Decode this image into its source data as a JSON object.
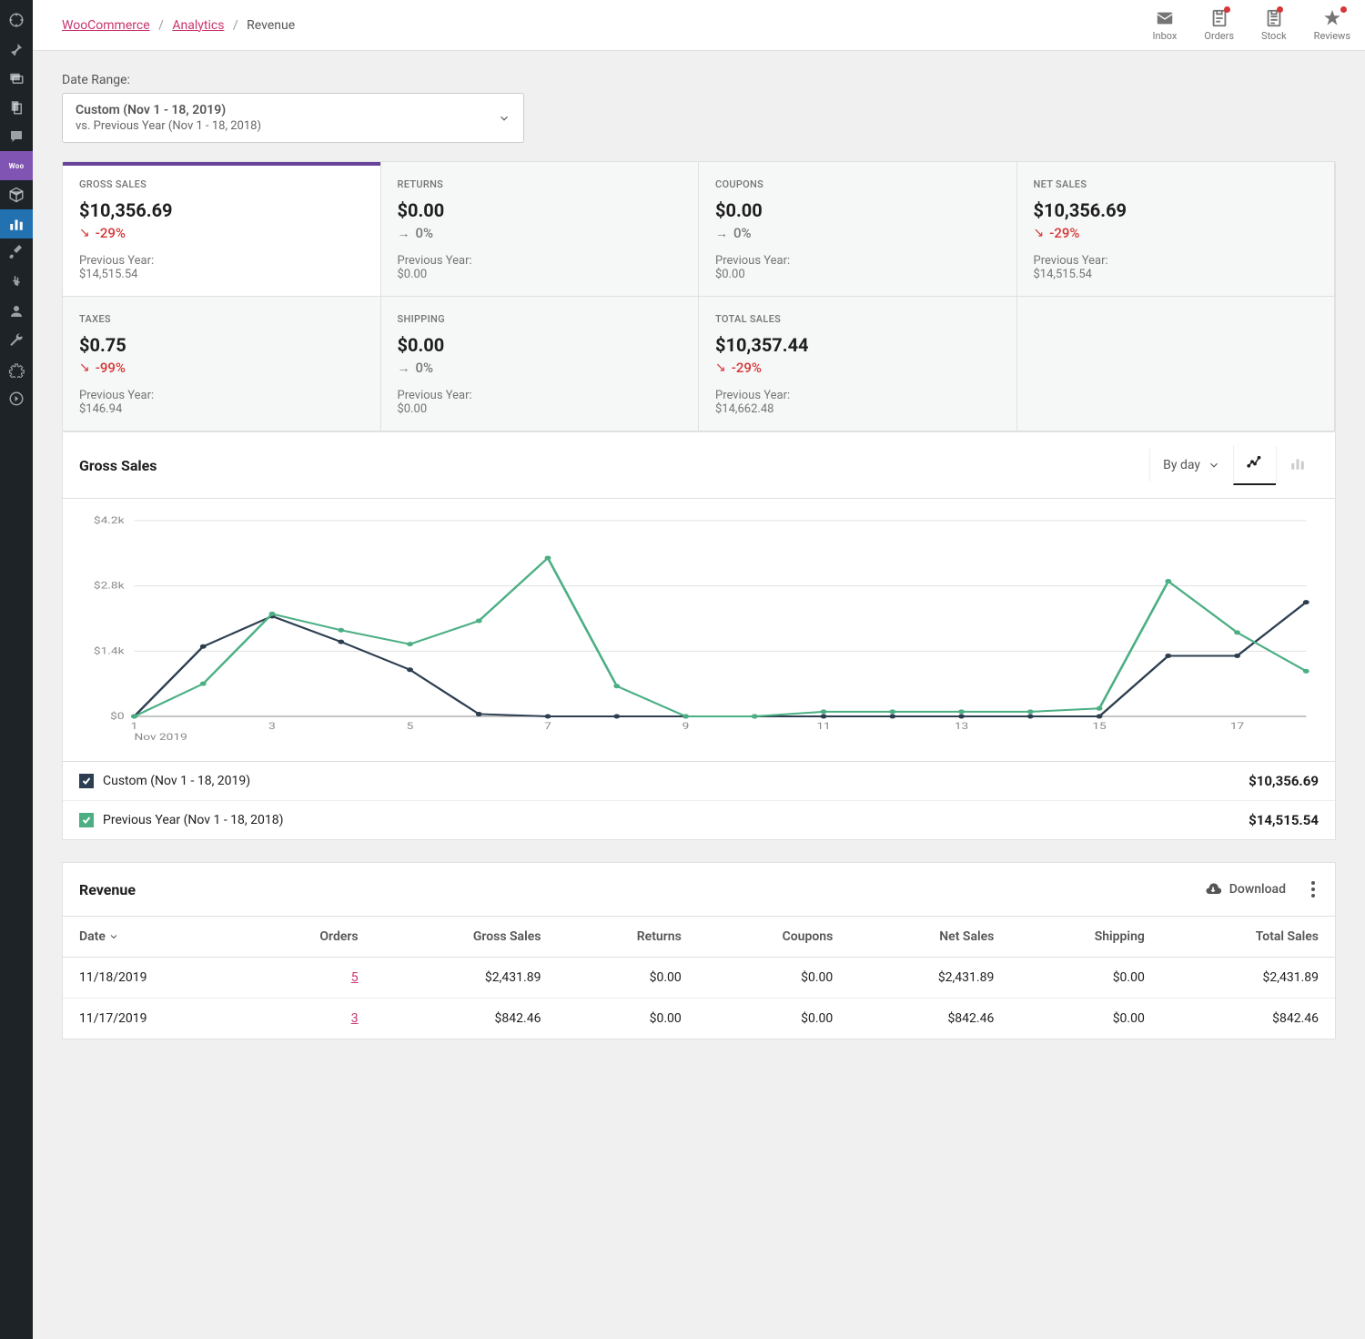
{
  "breadcrumbs": {
    "root": "WooCommerce",
    "section": "Analytics",
    "page": "Revenue"
  },
  "header": {
    "inbox": "Inbox",
    "orders": "Orders",
    "stock": "Stock",
    "reviews": "Reviews"
  },
  "date_range": {
    "label": "Date Range:",
    "title": "Custom (Nov 1 - 18, 2019)",
    "compare": "vs. Previous Year (Nov 1 - 18, 2018)"
  },
  "kpis": {
    "gross_sales": {
      "label": "GROSS SALES",
      "value": "$10,356.69",
      "delta": "-29%",
      "trend": "down",
      "prev_label": "Previous Year:",
      "prev": "$14,515.54"
    },
    "returns": {
      "label": "RETURNS",
      "value": "$0.00",
      "delta": "0%",
      "trend": "flat",
      "prev_label": "Previous Year:",
      "prev": "$0.00"
    },
    "coupons": {
      "label": "COUPONS",
      "value": "$0.00",
      "delta": "0%",
      "trend": "flat",
      "prev_label": "Previous Year:",
      "prev": "$0.00"
    },
    "net_sales": {
      "label": "NET SALES",
      "value": "$10,356.69",
      "delta": "-29%",
      "trend": "down",
      "prev_label": "Previous Year:",
      "prev": "$14,515.54"
    },
    "taxes": {
      "label": "TAXES",
      "value": "$0.75",
      "delta": "-99%",
      "trend": "down",
      "prev_label": "Previous Year:",
      "prev": "$146.94"
    },
    "shipping": {
      "label": "SHIPPING",
      "value": "$0.00",
      "delta": "0%",
      "trend": "flat",
      "prev_label": "Previous Year:",
      "prev": "$0.00"
    },
    "total_sales": {
      "label": "TOTAL SALES",
      "value": "$10,357.44",
      "delta": "-29%",
      "trend": "down",
      "prev_label": "Previous Year:",
      "prev": "$14,662.48"
    }
  },
  "chart": {
    "title": "Gross Sales",
    "interval": "By day",
    "legend_current": {
      "label": "Custom (Nov 1 - 18, 2019)",
      "total": "$10,356.69",
      "color": "#2c3e50"
    },
    "legend_prev": {
      "label": "Previous Year (Nov 1 - 18, 2018)",
      "total": "$14,515.54",
      "color": "#4caf84"
    },
    "x_label": "Nov 2019",
    "y_ticks": [
      "$0",
      "$1.4k",
      "$2.8k",
      "$4.2k"
    ],
    "x_ticks": [
      "1",
      "3",
      "5",
      "7",
      "9",
      "11",
      "13",
      "15",
      "17"
    ]
  },
  "chart_data": {
    "type": "line",
    "x": [
      1,
      2,
      3,
      4,
      5,
      6,
      7,
      8,
      9,
      10,
      11,
      12,
      13,
      14,
      15,
      16,
      17,
      18
    ],
    "title": "Gross Sales",
    "xlabel": "Nov 2019",
    "ylabel": "",
    "ylim": [
      0,
      4200
    ],
    "series": [
      {
        "name": "Custom (Nov 1 - 18, 2019)",
        "color": "#2c3e50",
        "values": [
          0,
          1500,
          2150,
          1600,
          1000,
          50,
          0,
          0,
          0,
          0,
          0,
          0,
          0,
          0,
          0,
          1300,
          1300,
          2450
        ]
      },
      {
        "name": "Previous Year (Nov 1 - 18, 2018)",
        "color": "#4caf84",
        "values": [
          0,
          700,
          2200,
          1850,
          1550,
          2050,
          3400,
          650,
          0,
          0,
          100,
          100,
          100,
          100,
          170,
          2900,
          1800,
          970
        ]
      }
    ]
  },
  "table": {
    "title": "Revenue",
    "download": "Download",
    "columns": [
      "Date",
      "Orders",
      "Gross Sales",
      "Returns",
      "Coupons",
      "Net Sales",
      "Shipping",
      "Total Sales"
    ],
    "rows": [
      {
        "date": "11/18/2019",
        "orders": "5",
        "gross": "$2,431.89",
        "returns": "$0.00",
        "coupons": "$0.00",
        "net": "$2,431.89",
        "shipping": "$0.00",
        "total": "$2,431.89"
      },
      {
        "date": "11/17/2019",
        "orders": "3",
        "gross": "$842.46",
        "returns": "$0.00",
        "coupons": "$0.00",
        "net": "$842.46",
        "shipping": "$0.00",
        "total": "$842.46"
      }
    ]
  }
}
